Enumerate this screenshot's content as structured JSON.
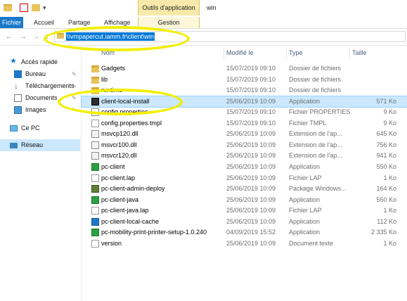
{
  "window": {
    "title": "win"
  },
  "ribbon": {
    "context_tab": "Outils d'application",
    "tabs": [
      "Fichier",
      "Accueil",
      "Partage",
      "Affichage",
      "Gestion"
    ]
  },
  "address": {
    "path": "\\\\vmpapercut.iamm.fr\\client\\win"
  },
  "nav": [
    {
      "label": "Accès rapide",
      "icon": "star-icon"
    },
    {
      "label": "Bureau",
      "icon": "desktop-icon",
      "pinned": true
    },
    {
      "label": "Téléchargements",
      "icon": "download-icon",
      "pinned": true
    },
    {
      "label": "Documents",
      "icon": "documents-icon",
      "pinned": true
    },
    {
      "label": "Images",
      "icon": "images-icon",
      "pinned": true
    },
    {
      "label": "Ce PC",
      "icon": "computer-icon"
    },
    {
      "label": "Réseau",
      "icon": "network-icon",
      "selected": true
    }
  ],
  "columns": {
    "name": "Nom",
    "date": "Modifié le",
    "type": "Type",
    "size": "Taille"
  },
  "files": [
    {
      "name": "Gadgets",
      "date": "15/07/2019 09:10",
      "type": "Dossier de fichiers",
      "size": "",
      "icon": "folder"
    },
    {
      "name": "lib",
      "date": "15/07/2019 09:10",
      "type": "Dossier de fichiers",
      "size": "",
      "icon": "folder"
    },
    {
      "name": "runtime",
      "date": "15/07/2019 09:10",
      "type": "Dossier de fichiers",
      "size": "",
      "icon": "folder"
    },
    {
      "name": "client-local-install",
      "date": "25/06/2019 10:09",
      "type": "Application",
      "size": "571 Ko",
      "icon": "app-dark",
      "selected": true
    },
    {
      "name": "config.properties",
      "date": "15/07/2019 09:10",
      "type": "Fichier PROPERTIES",
      "size": "9 Ko",
      "icon": "cfg"
    },
    {
      "name": "config.properties.tmpl",
      "date": "15/07/2019 09:10",
      "type": "Fichier TMPL",
      "size": "9 Ko",
      "icon": "doc"
    },
    {
      "name": "msvcp120.dll",
      "date": "25/06/2019 10:09",
      "type": "Extension de l'ap...",
      "size": "645 Ko",
      "icon": "dll"
    },
    {
      "name": "msvcr100.dll",
      "date": "25/06/2019 10:09",
      "type": "Extension de l'ap...",
      "size": "756 Ko",
      "icon": "dll"
    },
    {
      "name": "msvcr120.dll",
      "date": "25/06/2019 10:09",
      "type": "Extension de l'ap...",
      "size": "941 Ko",
      "icon": "dll"
    },
    {
      "name": "pc-client",
      "date": "25/06/2019 10:09",
      "type": "Application",
      "size": "550 Ko",
      "icon": "app-green"
    },
    {
      "name": "pc-client.lap",
      "date": "25/06/2019 10:09",
      "type": "Fichier LAP",
      "size": "1 Ko",
      "icon": "lap"
    },
    {
      "name": "pc-client-admin-deploy",
      "date": "25/06/2019 10:09",
      "type": "Package Windows...",
      "size": "164 Ko",
      "icon": "pkg"
    },
    {
      "name": "pc-client-java",
      "date": "25/06/2019 10:09",
      "type": "Application",
      "size": "550 Ko",
      "icon": "app-green"
    },
    {
      "name": "pc-client-java.lap",
      "date": "25/06/2019 10:09",
      "type": "Fichier LAP",
      "size": "1 Ko",
      "icon": "lap"
    },
    {
      "name": "pc-client-local-cache",
      "date": "25/06/2019 10:09",
      "type": "Application",
      "size": "112 Ko",
      "icon": "app-blue"
    },
    {
      "name": "pc-mobility-print-printer-setup-1.0.240",
      "date": "04/09/2019 15:52",
      "type": "Application",
      "size": "2 335 Ko",
      "icon": "app-green"
    },
    {
      "name": "version",
      "date": "25/06/2019 10:09",
      "type": "Document texte",
      "size": "1 Ko",
      "icon": "doc"
    }
  ]
}
